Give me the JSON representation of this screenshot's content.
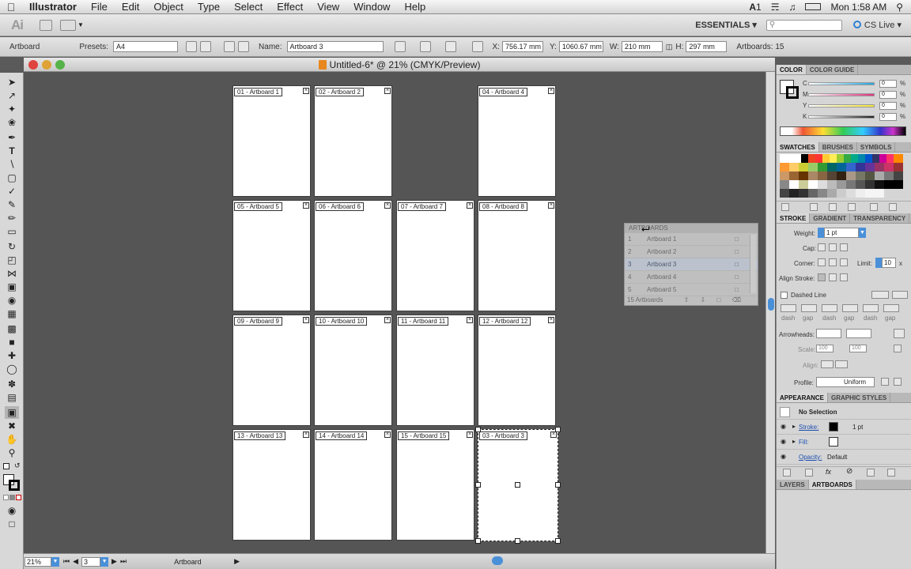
{
  "menubar": {
    "app_name": "Illustrator",
    "items": [
      "File",
      "Edit",
      "Object",
      "Type",
      "Select",
      "Effect",
      "View",
      "Window",
      "Help"
    ],
    "right": {
      "badge": "1",
      "clock": "Mon 1:58 AM"
    }
  },
  "appbar": {
    "logo": "Ai",
    "workspace": "ESSENTIALS",
    "cslive": "CS Live"
  },
  "control": {
    "tool_label": "Artboard",
    "presets_label": "Presets:",
    "preset_value": "A4",
    "name_label": "Name:",
    "name_value": "Artboard 3",
    "x_label": "X:",
    "x_value": "756.17 mm",
    "y_label": "Y:",
    "y_value": "1060.67 mm",
    "w_label": "W:",
    "w_value": "210 mm",
    "h_label": "H:",
    "h_value": "297 mm",
    "count_label": "Artboards: 15"
  },
  "document": {
    "title": "Untitled-6* @ 21% (CMYK/Preview)"
  },
  "artboards": [
    {
      "label": "01 - Artboard 1"
    },
    {
      "label": "02 - Artboard 2"
    },
    {
      "label": "04 - Artboard 4"
    },
    {
      "label": "05 - Artboard 5"
    },
    {
      "label": "06 - Artboard 6"
    },
    {
      "label": "07 - Artboard 7"
    },
    {
      "label": "08 - Artboard 8"
    },
    {
      "label": "09 - Artboard 9"
    },
    {
      "label": "10 - Artboard 10"
    },
    {
      "label": "11 - Artboard 11"
    },
    {
      "label": "12 - Artboard 12"
    },
    {
      "label": "13 - Artboard 13"
    },
    {
      "label": "14 - Artboard 14"
    },
    {
      "label": "15 - Artboard 15"
    },
    {
      "label": "03 - Artboard 3"
    }
  ],
  "artboards_panel": {
    "title": "ARTBOARDS",
    "rows": [
      {
        "num": "1",
        "name": "Artboard 1"
      },
      {
        "num": "2",
        "name": "Artboard 2"
      },
      {
        "num": "3",
        "name": "Artboard 3"
      },
      {
        "num": "4",
        "name": "Artboard 4"
      },
      {
        "num": "5",
        "name": "Artboard 5"
      }
    ],
    "footer": "15 Artboards"
  },
  "status": {
    "zoom": "21%",
    "page": "3",
    "tool": "Artboard"
  },
  "color_panel": {
    "tabs": [
      "COLOR",
      "COLOR GUIDE"
    ],
    "channels": [
      {
        "label": "C",
        "value": "0",
        "color": "#27a8e0"
      },
      {
        "label": "M",
        "value": "0",
        "color": "#e0347f"
      },
      {
        "label": "Y",
        "value": "0",
        "color": "#f4e63a"
      },
      {
        "label": "K",
        "value": "0",
        "color": "#222222"
      }
    ],
    "unit": "%"
  },
  "swatches_panel": {
    "tabs": [
      "SWATCHES",
      "BRUSHES",
      "SYMBOLS"
    ]
  },
  "stroke_panel": {
    "tabs": [
      "STROKE",
      "GRADIENT",
      "TRANSPARENCY"
    ],
    "weight_label": "Weight:",
    "weight_value": "1 pt",
    "cap_label": "Cap:",
    "corner_label": "Corner:",
    "limit_label": "Limit:",
    "limit_value": "10",
    "align_label": "Align Stroke:",
    "dashed_label": "Dashed Line",
    "dash_labels": [
      "dash",
      "gap",
      "dash",
      "gap",
      "dash",
      "gap"
    ],
    "arrowheads_label": "Arrowheads:",
    "scale_label": "Scale:",
    "scale_1": "100",
    "scale_2": "100",
    "align2_label": "Align:",
    "profile_label": "Profile:",
    "profile_value": "Uniform"
  },
  "appearance_panel": {
    "tabs": [
      "APPEARANCE",
      "GRAPHIC STYLES"
    ],
    "selection": "No Selection",
    "stroke_label": "Stroke:",
    "stroke_value": "1 pt",
    "fill_label": "Fill:",
    "opacity_label": "Opacity:",
    "opacity_value": "Default"
  },
  "layers_panel": {
    "tabs": [
      "LAYERS",
      "ARTBOARDS"
    ]
  }
}
